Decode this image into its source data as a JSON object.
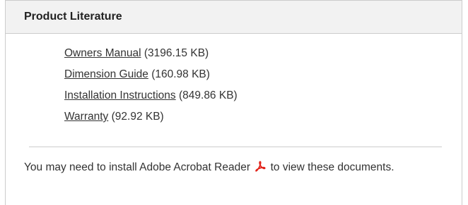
{
  "panel": {
    "title": "Product Literature"
  },
  "documents": [
    {
      "label": "Owners Manual",
      "size": "(3196.15 KB)"
    },
    {
      "label": "Dimension Guide",
      "size": "(160.98 KB)"
    },
    {
      "label": "Installation Instructions",
      "size": "(849.86 KB)"
    },
    {
      "label": "Warranty",
      "size": "(92.92 KB)"
    }
  ],
  "note": {
    "before": "You may need to install Adobe Acrobat Reader",
    "icon": "adobe-pdf-icon",
    "after": "to view these documents."
  },
  "colors": {
    "header_bg": "#f2f2f2",
    "border": "#cccccc",
    "text": "#333333",
    "pdf_red": "#e2231a"
  }
}
